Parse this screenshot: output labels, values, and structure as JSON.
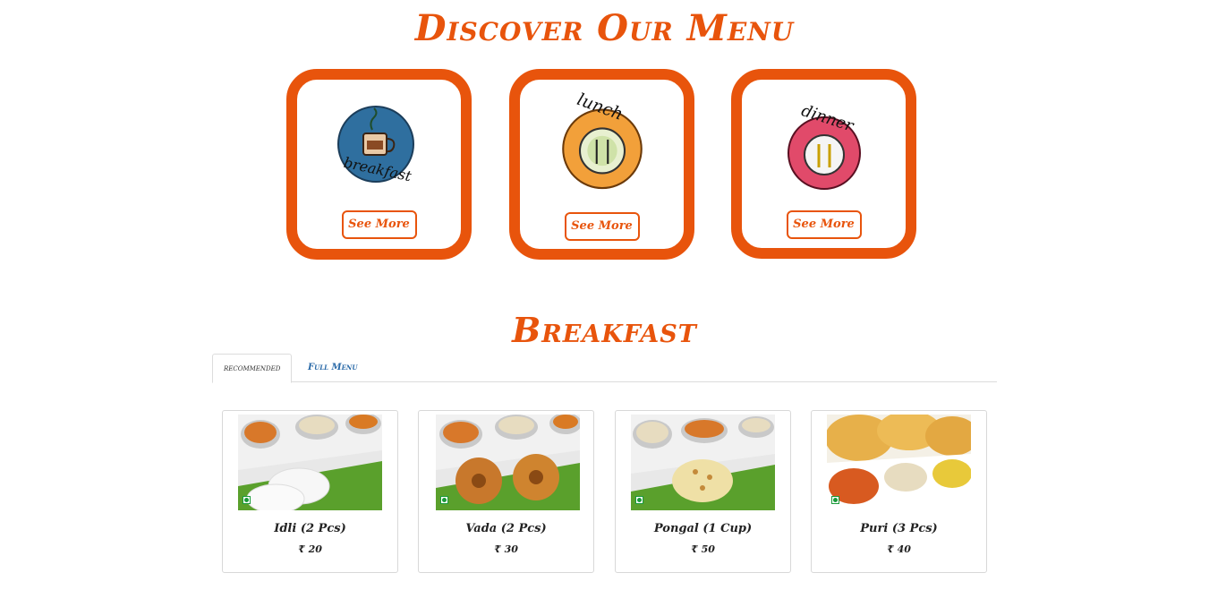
{
  "page": {
    "title": "Discover Our Menu"
  },
  "menus": [
    {
      "name": "breakfast",
      "button_label": "See More"
    },
    {
      "name": "lunch",
      "button_label": "See More"
    },
    {
      "name": "dinner",
      "button_label": "See More"
    }
  ],
  "section": {
    "title": "Breakfast"
  },
  "tabs": [
    {
      "label": "recommended",
      "active": true
    },
    {
      "label": "Full Menu",
      "active": false
    }
  ],
  "items": [
    {
      "name": "Idli (2 Pcs)",
      "price": "₹ 20",
      "icon": "veg-icon"
    },
    {
      "name": "Vada (2 Pcs)",
      "price": "₹ 30",
      "icon": "veg-icon"
    },
    {
      "name": "Pongal (1 Cup)",
      "price": "₹ 50",
      "icon": "veg-icon"
    },
    {
      "name": "Puri (3 Pcs)",
      "price": "₹ 40",
      "icon": "veg-icon"
    }
  ],
  "colors": {
    "accent": "#e8540c",
    "link": "#2a6aa8",
    "veg": "#1a9a3a"
  }
}
